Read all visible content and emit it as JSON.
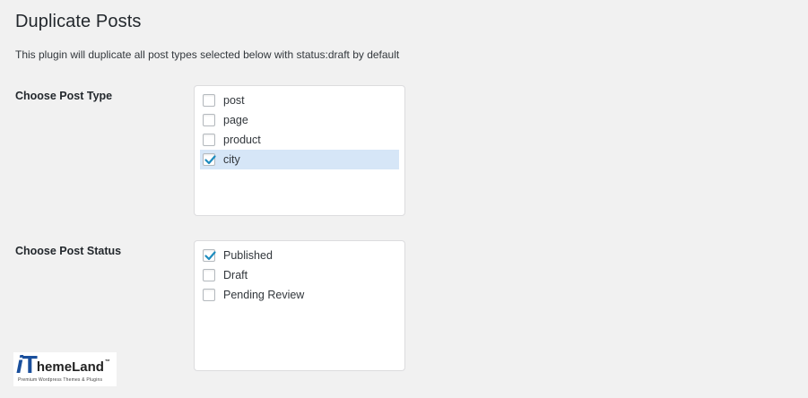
{
  "page": {
    "title": "Duplicate Posts",
    "description": "This plugin will duplicate all post types selected below with status:draft by default"
  },
  "post_type": {
    "label": "Choose Post Type",
    "options": [
      {
        "label": "post",
        "checked": false
      },
      {
        "label": "page",
        "checked": false
      },
      {
        "label": "product",
        "checked": false
      },
      {
        "label": "city",
        "checked": true
      }
    ]
  },
  "post_status": {
    "label": "Choose Post Status",
    "options": [
      {
        "label": "Published",
        "checked": true
      },
      {
        "label": "Draft",
        "checked": false
      },
      {
        "label": "Pending Review",
        "checked": false
      }
    ]
  },
  "logo": {
    "brand_i": "i",
    "brand_t": "T",
    "brand_rest": "hemeLand",
    "trademark": "™",
    "tagline": "Premium Wordpress Themes & Plugins"
  },
  "colors": {
    "background": "#f1f1f1",
    "checkmark": "#1e8cbe",
    "selected_row": "#d6e6f7",
    "logo_blue": "#1a4f9c"
  }
}
